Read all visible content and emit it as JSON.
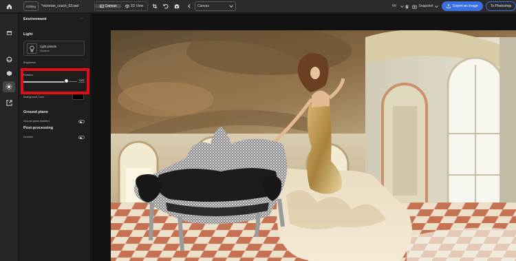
{
  "topbar": {
    "mode_badge": "Editing",
    "filename": "*victorian_couch_03.ssd",
    "view_canvas": "Canvas",
    "view_3d": "3D View",
    "canvas_select": "Canvas",
    "fit": "Fit",
    "snapshot": "Snapshot",
    "export": "Export an image",
    "photoshop": "To Photoshop"
  },
  "panel": {
    "title": "Environment",
    "more": "···",
    "light_heading": "Light",
    "preset_name": "Light presets",
    "preset_sub": "Studioer",
    "brightness_label": "Brightness",
    "rotation_label": "Rotation",
    "rotation_value": "+102",
    "bg_color_label": "Background Color",
    "ground_heading": "Ground plane",
    "ground_enabled_label": "Ground plane enabled",
    "post_heading": "Post-processing",
    "denoise_label": "Denoise"
  },
  "state": {
    "rotation_fraction": 0.8,
    "ground_plane_enabled": false,
    "denoise": false,
    "background_color": "#000000",
    "accent_color": "#3b6fe0",
    "highlight_color": "#e01016"
  },
  "icons": [
    "home-icon",
    "canvas-icon",
    "cube-icon",
    "crop-icon",
    "undo-icon",
    "camera-icon",
    "chevron-left-icon",
    "chevron-down-icon",
    "hand-icon",
    "snapshot-icon",
    "export-icon",
    "layers-icon",
    "sphere-icon",
    "materials-icon",
    "environment-icon",
    "export-panel-icon",
    "bulb-icon"
  ]
}
